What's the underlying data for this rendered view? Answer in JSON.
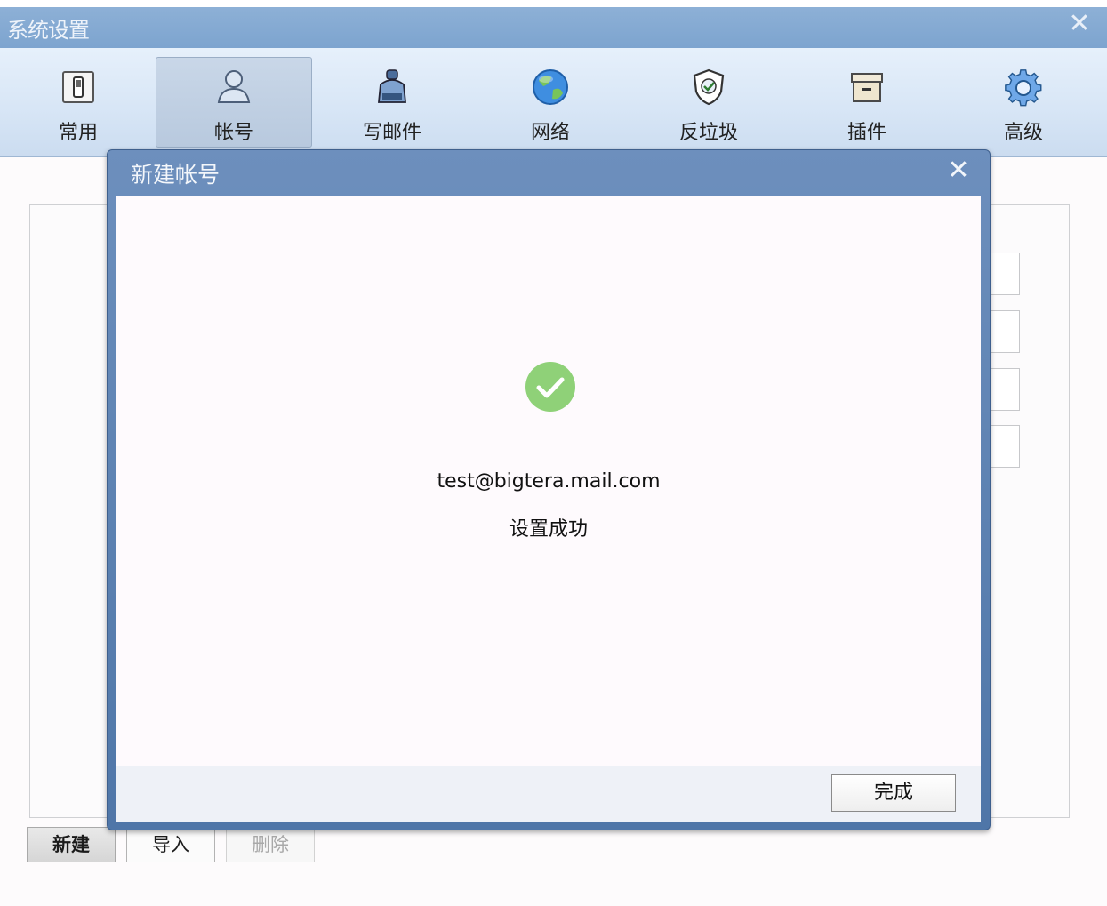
{
  "window": {
    "title": "系统设置"
  },
  "toolbar": {
    "tabs": [
      {
        "label": "常用",
        "icon": "phone-icon"
      },
      {
        "label": "帐号",
        "icon": "user-icon",
        "active": true
      },
      {
        "label": "写邮件",
        "icon": "ink-bottle-icon"
      },
      {
        "label": "网络",
        "icon": "globe-icon"
      },
      {
        "label": "反垃圾",
        "icon": "shield-check-icon"
      },
      {
        "label": "插件",
        "icon": "archive-box-icon"
      },
      {
        "label": "高级",
        "icon": "gear-icon"
      }
    ]
  },
  "actions": {
    "new": "新建",
    "import": "导入",
    "delete": "删除"
  },
  "modal": {
    "title": "新建帐号",
    "email": "test@bigtera.mail.com",
    "message": "设置成功",
    "done": "完成"
  },
  "colors": {
    "titlebar": "#7da4cf",
    "modal_header": "#5b80b2",
    "success": "#8fd178"
  }
}
